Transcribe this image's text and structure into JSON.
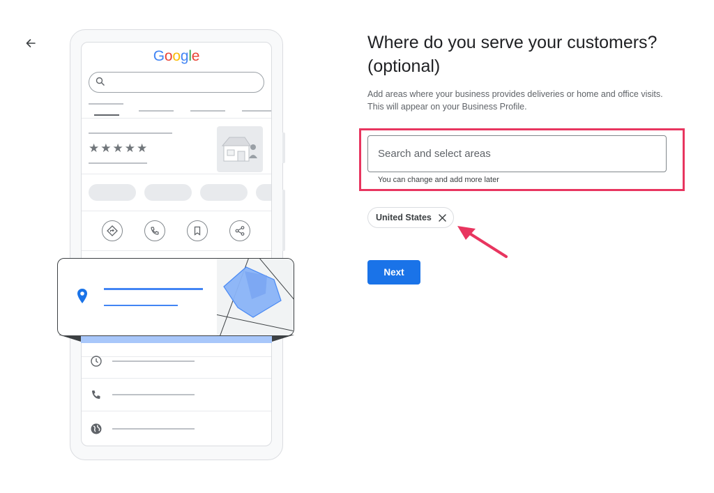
{
  "navigation": {
    "back_icon": "arrow-left-icon"
  },
  "illustration": {
    "logo_text": "Google",
    "rating_stars": "★★★★★",
    "action_icons": [
      "directions-icon",
      "phone-icon",
      "bookmark-icon",
      "share-icon"
    ],
    "info_icons": [
      "clock-icon",
      "phone-icon",
      "globe-icon"
    ],
    "pin_color": "#1a73e8",
    "area_color": "#8ab4f8"
  },
  "form": {
    "title": "Where do you serve your customers? (optional)",
    "description": "Add areas where your business provides deliveries or home and office visits. This will appear on your Business Profile.",
    "search": {
      "placeholder": "Search and select areas",
      "value": "",
      "helper": "You can change and add more later"
    },
    "chips": [
      {
        "label": "United States",
        "remove_icon": "close-icon"
      }
    ],
    "next_label": "Next"
  },
  "annotations": {
    "highlight_color": "#e8355f",
    "arrow_color": "#e8355f"
  },
  "colors": {
    "primary": "#1a73e8",
    "text": "#202124",
    "secondary_text": "#5f6368"
  }
}
